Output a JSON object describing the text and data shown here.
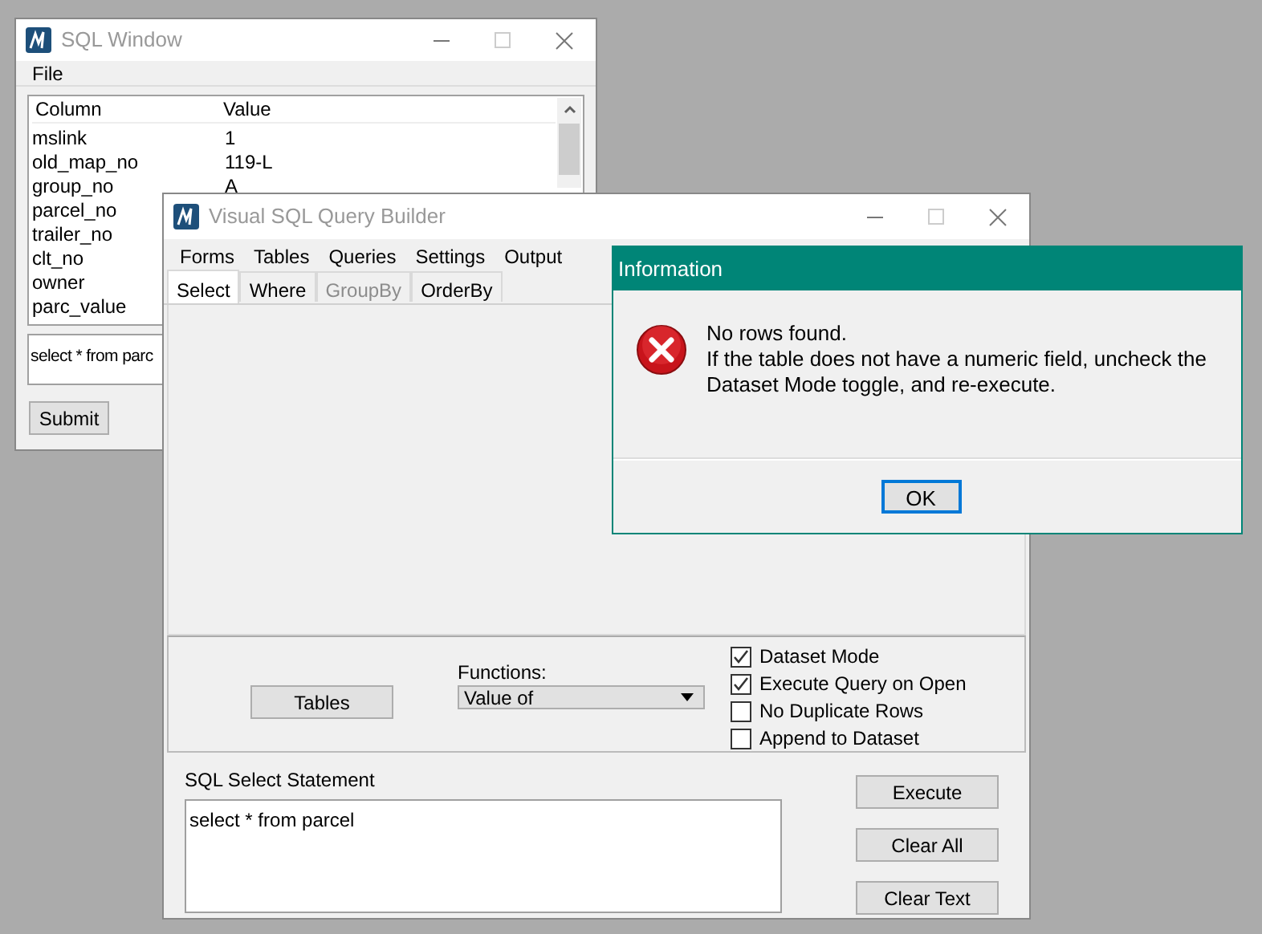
{
  "sql_window": {
    "title": "SQL Window",
    "menu": [
      {
        "label": "File"
      }
    ],
    "results": {
      "columns": [
        "Column",
        "Value"
      ],
      "rows": [
        {
          "column": "mslink",
          "value": "1"
        },
        {
          "column": "old_map_no",
          "value": "119-L"
        },
        {
          "column": "group_no",
          "value": "A"
        },
        {
          "column": "parcel_no"
        },
        {
          "column": "trailer_no"
        },
        {
          "column": "clt_no"
        },
        {
          "column": "owner"
        },
        {
          "column": "parc_value"
        }
      ]
    },
    "statement": "select * from parc",
    "submit": {
      "label": "Submit"
    }
  },
  "query_builder": {
    "title": "Visual SQL Query Builder",
    "menu": [
      {
        "label": "Forms"
      },
      {
        "label": "Tables"
      },
      {
        "label": "Queries"
      },
      {
        "label": "Settings"
      },
      {
        "label": "Output"
      }
    ],
    "tabs": [
      {
        "label": "Select",
        "selected": true,
        "disabled": false
      },
      {
        "label": "Where",
        "selected": false,
        "disabled": false
      },
      {
        "label": "GroupBy",
        "selected": false,
        "disabled": true
      },
      {
        "label": "OrderBy",
        "selected": false,
        "disabled": false
      }
    ],
    "tables_button": {
      "label": "Tables"
    },
    "functions": {
      "label": "Functions:",
      "value": "Value of"
    },
    "options": [
      {
        "label": "Dataset Mode",
        "checked": true
      },
      {
        "label": "Execute Query on Open",
        "checked": true
      },
      {
        "label": "No Duplicate Rows",
        "checked": false
      },
      {
        "label": "Append to Dataset",
        "checked": false
      }
    ],
    "statement_label": "SQL Select Statement",
    "statement": "select * from parcel",
    "buttons": [
      {
        "label": "Execute"
      },
      {
        "label": "Clear All"
      },
      {
        "label": "Clear Text"
      }
    ]
  },
  "dialog": {
    "title": "Information",
    "message": [
      "No rows found.",
      "If the table does not have a numeric field, uncheck the",
      "Dataset Mode toggle, and re-execute."
    ],
    "button": {
      "label": "OK"
    }
  }
}
